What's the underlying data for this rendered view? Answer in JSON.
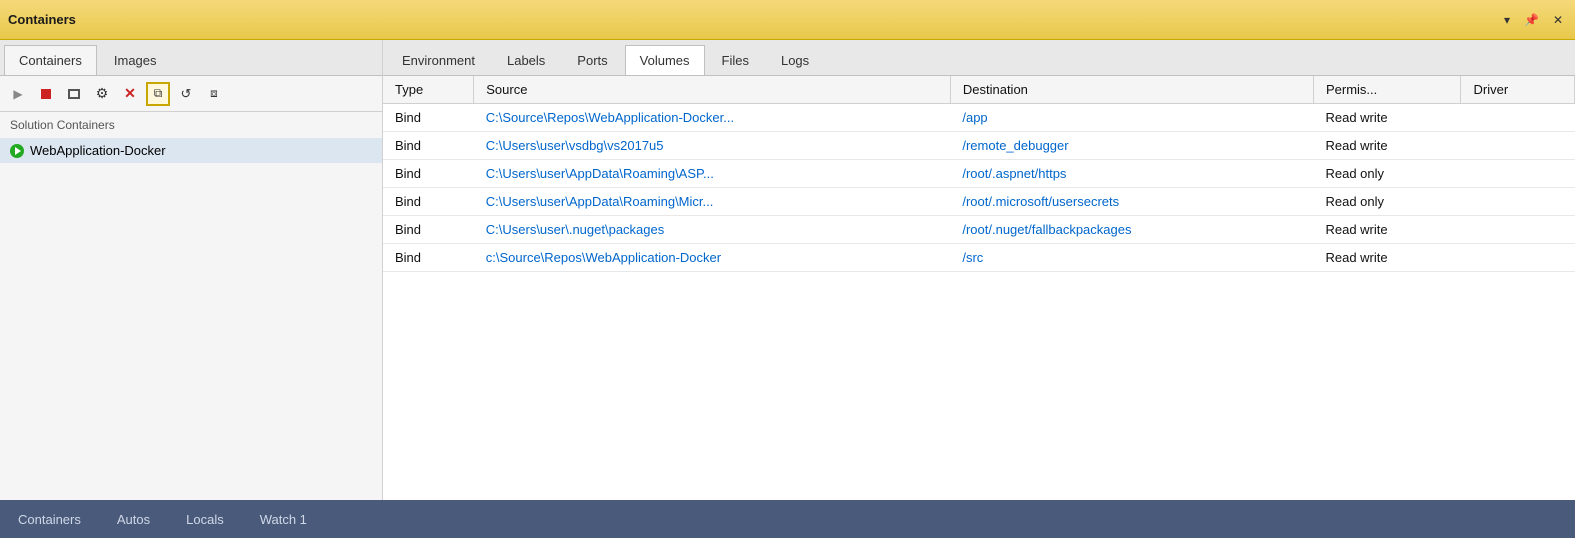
{
  "titleBar": {
    "title": "Containers",
    "controls": {
      "pin": "📌",
      "close": "✕"
    }
  },
  "sidebarTabs": [
    {
      "id": "containers",
      "label": "Containers",
      "active": true
    },
    {
      "id": "images",
      "label": "Images",
      "active": false
    }
  ],
  "toolbar": {
    "buttons": [
      {
        "id": "play",
        "tooltip": "Start"
      },
      {
        "id": "stop",
        "tooltip": "Stop"
      },
      {
        "id": "terminal",
        "tooltip": "Open Terminal"
      },
      {
        "id": "settings",
        "tooltip": "Settings"
      },
      {
        "id": "delete",
        "tooltip": "Delete"
      },
      {
        "id": "copy",
        "tooltip": "Copy"
      },
      {
        "id": "refresh",
        "tooltip": "Refresh"
      },
      {
        "id": "copy2",
        "tooltip": "Copy (2)"
      }
    ]
  },
  "sidebar": {
    "solutionHeader": "Solution Containers",
    "containers": [
      {
        "id": "webapp-docker",
        "name": "WebApplication-Docker",
        "running": true
      }
    ]
  },
  "rightTabs": [
    {
      "id": "environment",
      "label": "Environment",
      "active": false
    },
    {
      "id": "labels",
      "label": "Labels",
      "active": false
    },
    {
      "id": "ports",
      "label": "Ports",
      "active": false
    },
    {
      "id": "volumes",
      "label": "Volumes",
      "active": true
    },
    {
      "id": "files",
      "label": "Files",
      "active": false
    },
    {
      "id": "logs",
      "label": "Logs",
      "active": false
    }
  ],
  "table": {
    "columns": [
      {
        "id": "type",
        "label": "Type"
      },
      {
        "id": "source",
        "label": "Source"
      },
      {
        "id": "destination",
        "label": "Destination"
      },
      {
        "id": "permissions",
        "label": "Permis..."
      },
      {
        "id": "driver",
        "label": "Driver"
      }
    ],
    "rows": [
      {
        "type": "Bind",
        "source": "C:\\Source\\Repos\\WebApplication-Docker...",
        "destination": "/app",
        "permissions": "Read write",
        "driver": ""
      },
      {
        "type": "Bind",
        "source": "C:\\Users\\user\\vsdbg\\vs2017u5",
        "destination": "/remote_debugger",
        "permissions": "Read write",
        "driver": ""
      },
      {
        "type": "Bind",
        "source": "C:\\Users\\user\\AppData\\Roaming\\ASP...",
        "destination": "/root/.aspnet/https",
        "permissions": "Read only",
        "driver": ""
      },
      {
        "type": "Bind",
        "source": "C:\\Users\\user\\AppData\\Roaming\\Micr...",
        "destination": "/root/.microsoft/usersecrets",
        "permissions": "Read only",
        "driver": ""
      },
      {
        "type": "Bind",
        "source": "C:\\Users\\user\\.nuget\\packages",
        "destination": "/root/.nuget/fallbackpackages",
        "permissions": "Read write",
        "driver": ""
      },
      {
        "type": "Bind",
        "source": "c:\\Source\\Repos\\WebApplication-Docker",
        "destination": "/src",
        "permissions": "Read write",
        "driver": ""
      }
    ]
  },
  "bottomTabs": [
    {
      "id": "containers",
      "label": "Containers",
      "active": false
    },
    {
      "id": "autos",
      "label": "Autos",
      "active": false
    },
    {
      "id": "locals",
      "label": "Locals",
      "active": false
    },
    {
      "id": "watch1",
      "label": "Watch 1",
      "active": false
    }
  ]
}
